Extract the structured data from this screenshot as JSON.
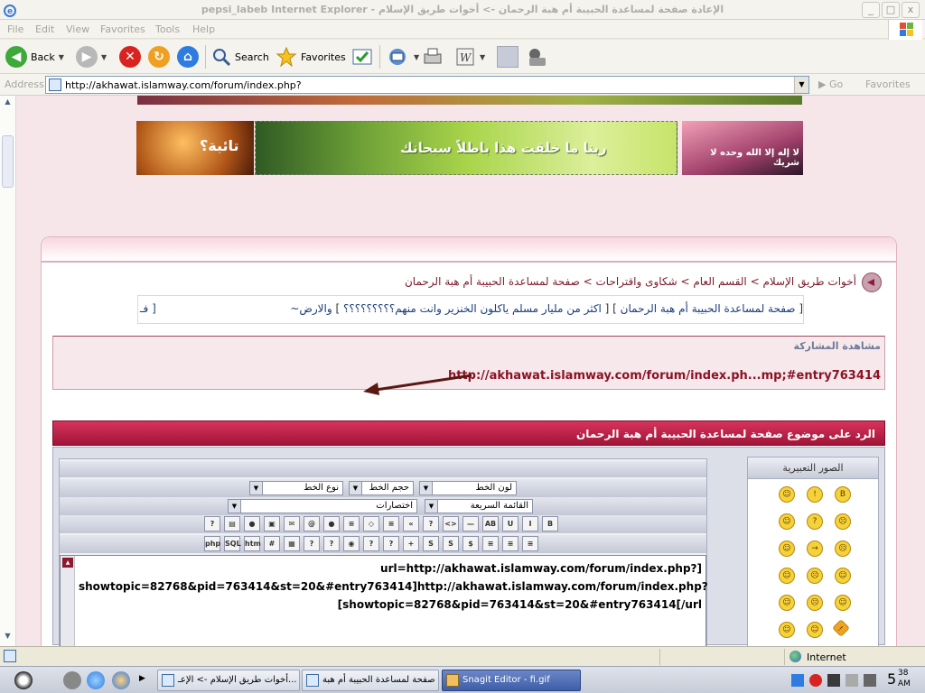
{
  "window": {
    "title": "pepsi_labeb Internet Explorer - الإعادة صفحة لمساعدة الحبيبة أم هبة الرحمان -> أخوات طريق الإسلام",
    "minimize": "_",
    "maximize": "□",
    "close": "x"
  },
  "menu": [
    "File",
    "Edit",
    "View",
    "Favorites",
    "Tools",
    "Help"
  ],
  "toolbar": {
    "back": "Back",
    "search": "Search",
    "favorites": "Favorites"
  },
  "address": {
    "label": "Address",
    "url": "http://akhawat.islamway.com/forum/index.php?",
    "go": "Go",
    "favorites": "Favorites"
  },
  "banners": {
    "left_text": "تائبة؟",
    "center_text": "ربنا ما خلقت هذا باطلاً سبحانك",
    "right_text": "لا إله إلا الله وحده لا شريك"
  },
  "breadcrumb": "أخوات طريق الإسلام > القسم العام > شكاوى واقتراحات > صفحة لمساعدة الحبيبة أم هبة الرحمان",
  "marquee": {
    "items": [
      "صفحة لمساعدة الحبيبة أم هبة الرحمان",
      "اكثر من مليار مسلم ياكلون الخنزير وانت منهم؟؟؟؟؟؟؟؟؟",
      "والارض~"
    ],
    "left_cut": "فـ"
  },
  "view_post": {
    "header": "مشاهدة المشاركة",
    "link": "http://akhawat.islamway.com/forum/index.ph...mp;#entry763414"
  },
  "reply": {
    "title": "الرد على موضوع صفحة لمساعدة الحبيبة أم هبة الرحمان"
  },
  "editor": {
    "font_color": "لون الخط",
    "font_size": "حجم الخط",
    "font_type": "نوع الخط",
    "quick_list": "القائمة السريعة",
    "shortcuts": "اختصارات",
    "text_lines": [
      "url=http://akhawat.islamway.com/forum/index.php?]",
      "showtopic=82768&pid=763414&st=20&#entry763414]http://akhawat.islamway.com/forum/index.php?",
      "[showtopic=82768&pid=763414&st=20&#entry763414[/url"
    ],
    "row1_buttons": [
      "B",
      "I",
      "U",
      "AB",
      "—",
      "<>",
      "?",
      "«",
      "≡",
      "◇",
      "≡",
      "●",
      "@",
      "✉",
      "▣",
      "●",
      "▤",
      "?"
    ],
    "row2_buttons": [
      "≡",
      "≡",
      "≡",
      "$",
      "S",
      "S",
      "+",
      "?",
      "?",
      "◉",
      "?",
      "?",
      "▦",
      "#",
      "htm",
      "SQL",
      "php"
    ]
  },
  "emoticons": {
    "header": "الصور التعبيرية",
    "glyphs": [
      "☺",
      "!",
      "B",
      "☺",
      "?",
      "☹",
      "☺",
      "→",
      "☹",
      "☺",
      "☹",
      "☺",
      "☺",
      "☹",
      "☺",
      "☺",
      "☺",
      "!"
    ]
  },
  "status": {
    "zone": "Internet"
  },
  "taskbar": {
    "tasks": [
      "أخوات طريق الإسلام -> الإعـ...",
      "صفحة لمساعدة الحبيبة أم هبة ...",
      "Snagit Editor - fi.gif"
    ],
    "clock_hour": "5",
    "clock_min": "38",
    "clock_ampm": "AM"
  },
  "colors": {
    "accent": "#a01538",
    "link": "#8b1224",
    "page_bg": "#f6e6ea"
  }
}
